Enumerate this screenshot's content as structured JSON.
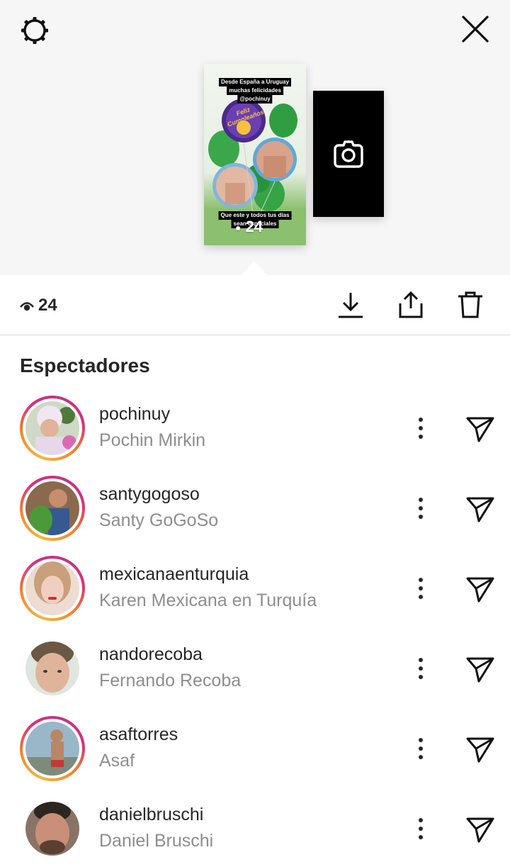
{
  "header": {
    "settings_icon": "gear-icon",
    "close_icon": "close-icon"
  },
  "story": {
    "caption_top_lines": [
      "Desde España a Uruguay",
      "muchas felicidades",
      "@pochinuy"
    ],
    "balloon_text": "Feliz Cumpleaños",
    "caption_bottom_lines": [
      "Que este y todos tus días",
      "sean especiales"
    ],
    "view_count": "24",
    "add_story_icon": "camera-icon"
  },
  "stats": {
    "view_count": "24",
    "actions": [
      "download-icon",
      "share-icon",
      "trash-icon"
    ]
  },
  "viewers_section": {
    "title": "Espectadores",
    "viewers": [
      {
        "username": "pochinuy",
        "full_name": "Pochin Mirkin",
        "has_story_ring": true
      },
      {
        "username": "santygogoso",
        "full_name": "Santy GoGoSo",
        "has_story_ring": true
      },
      {
        "username": "mexicanaenturquia",
        "full_name": "Karen Mexicana en Turquía",
        "has_story_ring": true
      },
      {
        "username": "nandorecoba",
        "full_name": "Fernando Recoba",
        "has_story_ring": false
      },
      {
        "username": "asaftorres",
        "full_name": "Asaf",
        "has_story_ring": true
      },
      {
        "username": "danielbruschi",
        "full_name": "Daniel Bruschi",
        "has_story_ring": false
      }
    ]
  },
  "colors": {
    "text_primary": "#262626",
    "text_secondary": "#8e8e8e",
    "story_ring_start": "#f9b43b",
    "story_ring_end": "#c13584",
    "top_background": "#f6f6f6"
  }
}
